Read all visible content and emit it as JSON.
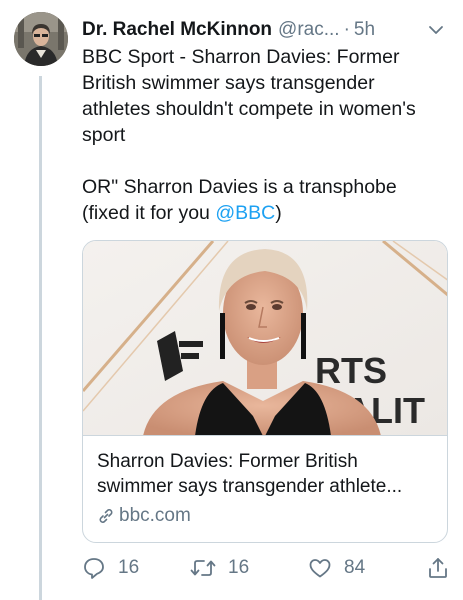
{
  "tweet": {
    "display_name": "Dr. Rachel McKinnon",
    "handle": "@rac...",
    "separator": "·",
    "time": "5h",
    "text_line_1": "BBC Sport - Sharron Davies: Former",
    "text_line_2": "British swimmer says transgender",
    "text_line_3": "athletes shouldn't compete in women's",
    "text_line_4": "sport",
    "text_line_5": "OR\" Sharron Davies is a transphobe",
    "text_line_6_prefix": "(fixed it for you ",
    "mention": "@BBC",
    "text_line_6_suffix": ")"
  },
  "card": {
    "backdrop_text_line_1": "RTS",
    "backdrop_text_line_2": "NALIT",
    "title_line_1": "Sharron Davies: Former British",
    "title_line_2": "swimmer says transgender athlete...",
    "domain": "bbc.com"
  },
  "actions": {
    "reply_count": "16",
    "retweet_count": "16",
    "like_count": "84"
  },
  "colors": {
    "link": "#1da1f2",
    "secondary_text": "#657786",
    "border": "#ccd6dd"
  },
  "icons": [
    "chevron-down-icon",
    "link-icon",
    "reply-icon",
    "retweet-icon",
    "like-icon",
    "share-icon"
  ]
}
